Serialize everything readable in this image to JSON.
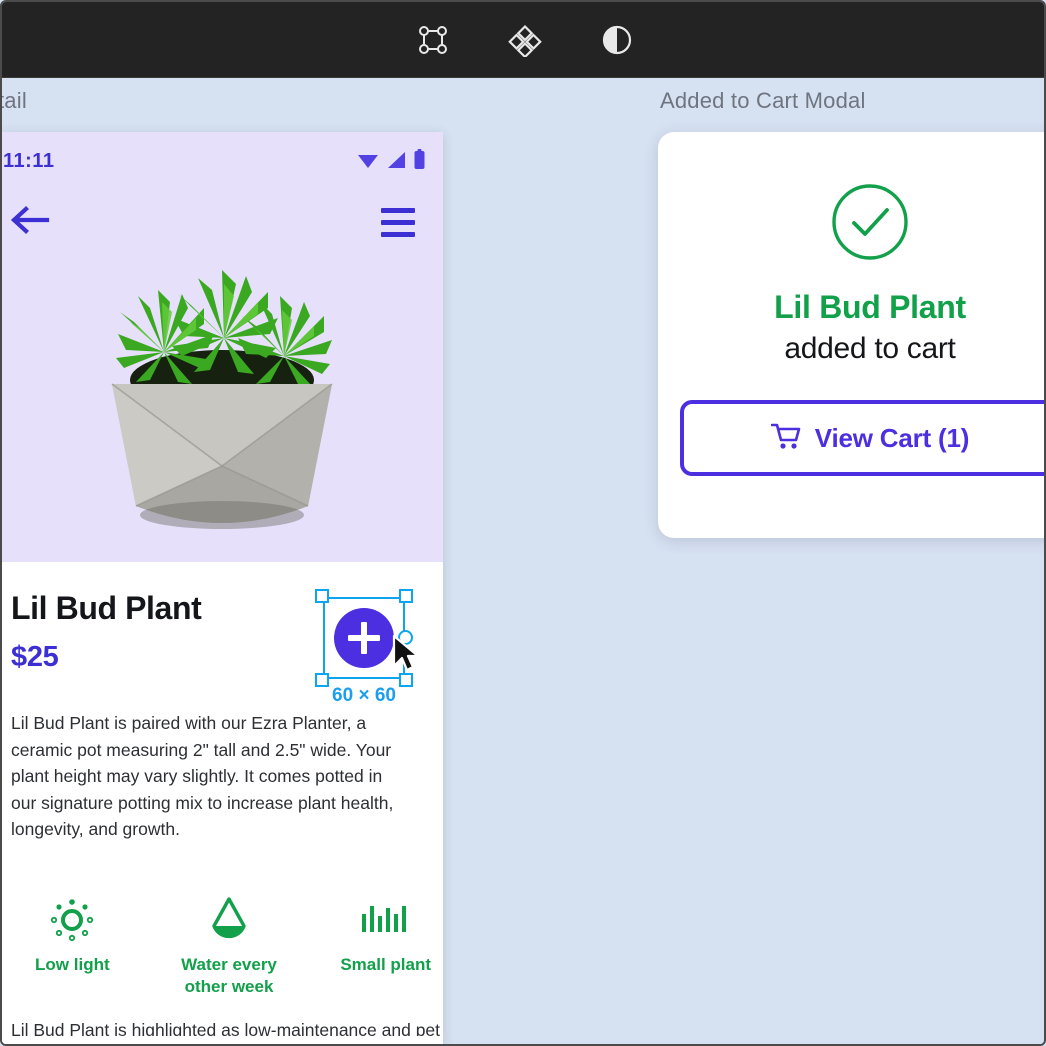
{
  "toolbar": {
    "tools": [
      {
        "name": "frame-tool",
        "icon": "frame-icon"
      },
      {
        "name": "component-tool",
        "icon": "diamond-component-icon"
      },
      {
        "name": "contrast-tool",
        "icon": "contrast-half-circle-icon"
      }
    ]
  },
  "canvas": {
    "background_color": "#d6e1f2",
    "frames": [
      {
        "label": "tail"
      },
      {
        "label": "Added to Cart Modal"
      }
    ]
  },
  "phone": {
    "status_bar": {
      "time": "11:11",
      "icons": [
        "wifi-icon",
        "signal-icon",
        "battery-icon"
      ]
    },
    "nav": {
      "back": "back-arrow-icon",
      "menu": "hamburger-menu-icon"
    },
    "hero": {
      "image_alt": "succulent-plant-in-concrete-pot",
      "background_color": "#e6e0fb"
    },
    "product": {
      "title": "Lil Bud Plant",
      "price": "$25",
      "description": "Lil Bud Plant is paired with our Ezra Planter, a ceramic pot measuring 2\" tall and 2.5\" wide. Your plant height may vary slightly. It comes potted in our signature potting mix to increase plant health, longevity, and growth.",
      "price_color": "#3c2fd4"
    },
    "features": [
      {
        "icon": "sun-low-light-icon",
        "label": "Low light"
      },
      {
        "icon": "water-drop-icon",
        "label": "Water every other week"
      },
      {
        "icon": "plant-size-bars-icon",
        "label": "Small plant"
      }
    ],
    "feature_color": "#12a04a",
    "bottom_text": "Lil Bud Plant is highlighted as low-maintenance and pet friendly"
  },
  "selection": {
    "element_name": "add-to-cart-fab",
    "size_label": "60 × 60",
    "fab_color": "#4b2fe0",
    "handle_color": "#0ea5f0",
    "plus_icon": "plus-icon"
  },
  "modal": {
    "check_icon": "check-circle-icon",
    "title": "Lil Bud Plant",
    "subtitle": "added to cart",
    "title_color": "#12a04a",
    "button": {
      "icon": "shopping-cart-icon",
      "label": "View Cart (1)",
      "accent_color": "#4b2fe0"
    }
  }
}
